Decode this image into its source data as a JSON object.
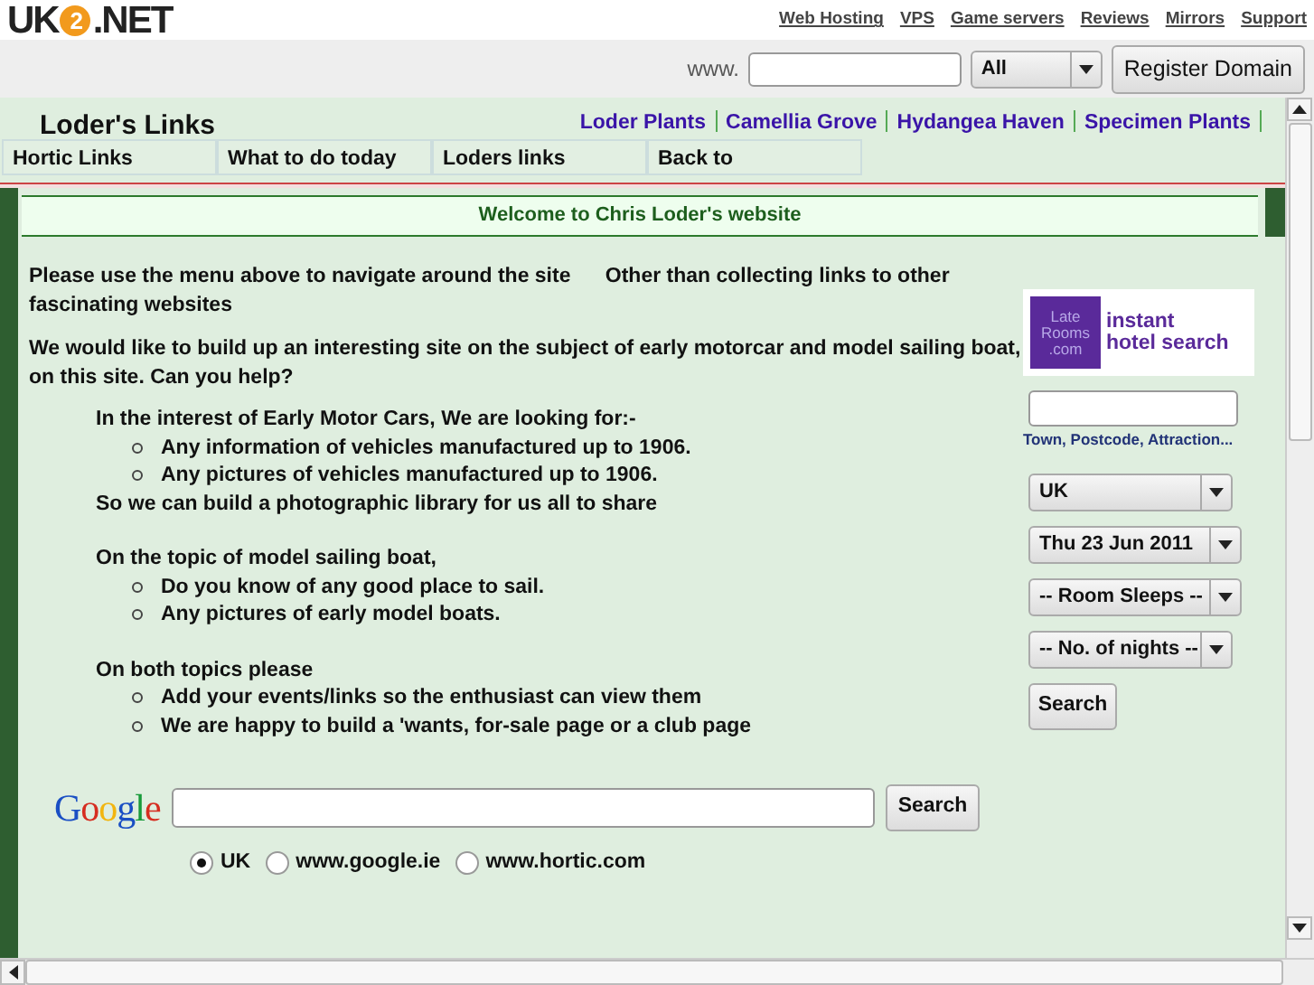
{
  "site_header": {
    "logo": {
      "left": "UK",
      "mark": "2",
      "right": ".NET"
    },
    "links": [
      "Web Hosting",
      "VPS",
      "Game servers",
      "Reviews",
      "Mirrors",
      "Support"
    ]
  },
  "domain_bar": {
    "prefix": "www.",
    "dropdown": "All",
    "button": "Register Domain"
  },
  "page": {
    "title": "Loder's Links",
    "top_links": [
      "Loder Plants",
      "Camellia Grove",
      "Hydangea Haven",
      "Specimen Plants"
    ],
    "nav": [
      "Hortic Links",
      "What to do today",
      "Loders links",
      "Back to"
    ],
    "welcome": "Welcome to Chris Loder's website",
    "paragraphs": [
      "Please use the menu above to navigate around the site      Other than collecting links to other fascinating websites",
      "We would like to build up an interesting site on the subject of early motorcar and model sailing boat, on this site. Can you help?"
    ],
    "sections": [
      {
        "heading": "In the interest of Early Motor Cars, We are looking for:-",
        "items": [
          "Any information of vehicles manufactured up to 1906.",
          "Any pictures of vehicles manufactured up to 1906."
        ],
        "note": "So we can build a photographic library for us all to share"
      },
      {
        "heading": "On the topic of model sailing boat,",
        "items": [
          "Do you know of any good place to sail.",
          "Any pictures of early model boats."
        ]
      },
      {
        "heading": "On both topics please",
        "items": [
          "Add your events/links so the enthusiast can view them",
          "We are happy to build a 'wants, for-sale page or a club page"
        ]
      }
    ],
    "google": {
      "logo": "Google",
      "button": "Search",
      "options": [
        {
          "label": "UK",
          "selected": true
        },
        {
          "label": "www.google.ie",
          "selected": false
        },
        {
          "label": "www.hortic.com",
          "selected": false
        }
      ]
    },
    "hotel": {
      "logo_mark": [
        "Late",
        "Rooms",
        ".com"
      ],
      "logo_text": [
        "instant",
        "hotel search"
      ],
      "caption": "Town, Postcode, Attraction...",
      "dropdowns": [
        "UK",
        "Thu 23 Jun 2011",
        "-- Room Sleeps --",
        "-- No. of nights --"
      ],
      "button": "Search"
    }
  }
}
